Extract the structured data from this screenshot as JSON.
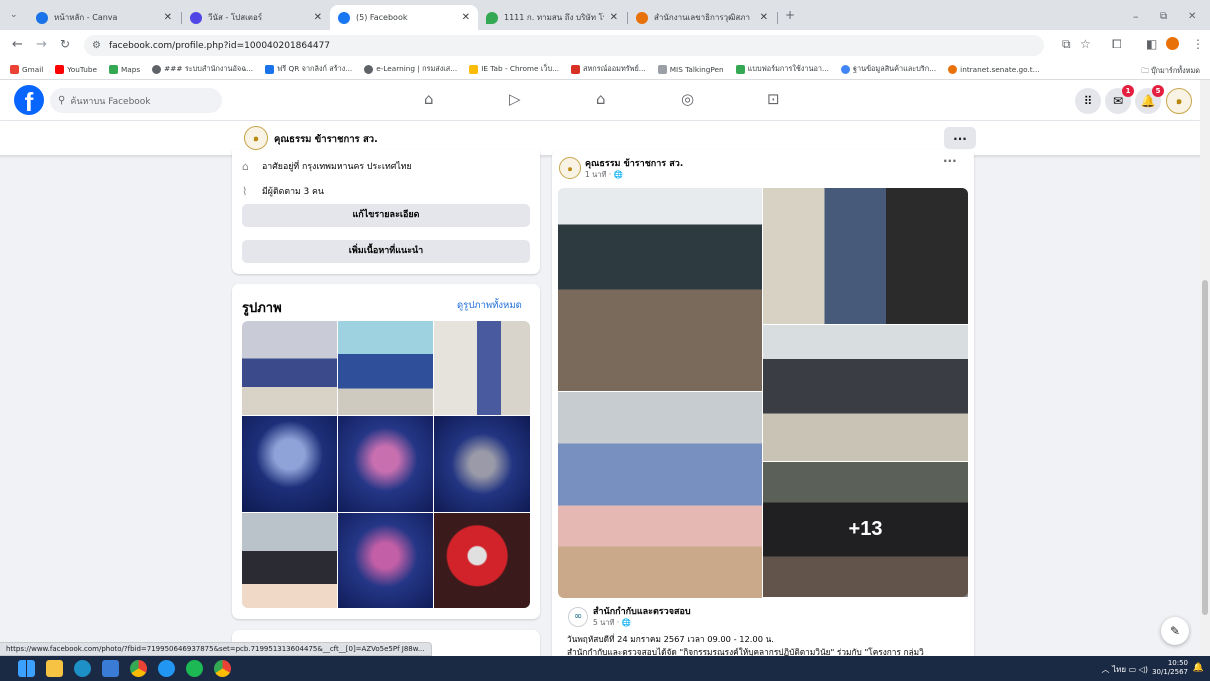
{
  "browser": {
    "tabs": [
      {
        "title": "หน้าหลัก - Canva",
        "color": "#1a73e8"
      },
      {
        "title": "วีนัส - โปสเตอร์",
        "color": "#4f46e5"
      },
      {
        "title": "(5) Facebook",
        "color": "#1877f2"
      },
      {
        "title": "1111 ก. ทามสน ถึง บริษัท โทสเต้ม",
        "color": "#34a853"
      },
      {
        "title": "สำนักงานเลขาธิการวุฒิสภา",
        "color": "#e8710a"
      }
    ],
    "new_tab": "+",
    "url": "facebook.com/profile.php?id=100040201864477",
    "bookmarks": [
      {
        "label": "Gmail",
        "color": "#ea4335"
      },
      {
        "label": "YouTube",
        "color": "#ff0000"
      },
      {
        "label": "Maps",
        "color": "#34a853"
      },
      {
        "label": "### ระบบสำนักงานอัจฉ...",
        "color": "#5f6368"
      },
      {
        "label": "ฟรี QR จากลิงก์ สร้าง...",
        "color": "#1a73e8"
      },
      {
        "label": "e-Learning | กรมส่งเส...",
        "color": "#5f6368"
      },
      {
        "label": "IE Tab - Chrome เว็บ...",
        "color": "#fbbc04"
      },
      {
        "label": "สหกรณ์ออมทรัพย์...",
        "color": "#d93025"
      },
      {
        "label": "MIS TalkingPen",
        "color": "#9aa0a6"
      },
      {
        "label": "แบบฟอร์มการใช้งานอา...",
        "color": "#34a853"
      },
      {
        "label": "ฐานข้อมูลสินค้าและบริก...",
        "color": "#4285f4"
      },
      {
        "label": "intranet.senate.go.t...",
        "color": "#e8710a"
      }
    ],
    "other_bookmarks": "บุ๊กมาร์กทั้งหมด",
    "status_url": "https://www.facebook.com/photo/?fbid=719950646937875&set=pcb.719951313604475&__cft__[0]=AZVo5e5Pf J88w..."
  },
  "facebook": {
    "logo": "f",
    "search_placeholder": "ค้นหาบน Facebook",
    "messenger_badge": "1",
    "notifications_badge": "5",
    "profile_name": "คุณธรรม ข้าราชการ สว.",
    "more_button": "...",
    "intro": {
      "lives_in": "อาศัยอยู่ที่ กรุงเทพมหานคร ประเทศไทย",
      "followers": "มีผู้ติดตาม 3 คน",
      "edit_details": "แก้ไขรายละเอียด",
      "add_featured": "เพิ่มเนื้อหาที่แนะนำ"
    },
    "photos": {
      "title": "รูปภาพ",
      "see_all": "ดูรูปภาพทั้งหมด"
    },
    "post": {
      "author": "คุณธรรม ข้าราชการ สว.",
      "time": "1 นาที · 🌐",
      "more": "···",
      "more_photos": "+13",
      "shared_page": "สำนักกำกับและตรวจสอบ",
      "shared_time": "5 นาที · 🌐",
      "text_line1": "วันพฤหัสบดีที่ 24 มกราคม 2567 เวลา 09.00 - 12.00 น.",
      "text_line2": "สำนักกำกับและตรวจสอบได้จัด \"กิจกรรมรณรงค์ให้บุคลากรปฏิบัติตามวินัย\" ร่วมกับ \"โครงการ กลุ่มวิ"
    }
  },
  "taskbar": {
    "time": "10:50",
    "date": "30/1/2567",
    "lang": "ไทย"
  }
}
